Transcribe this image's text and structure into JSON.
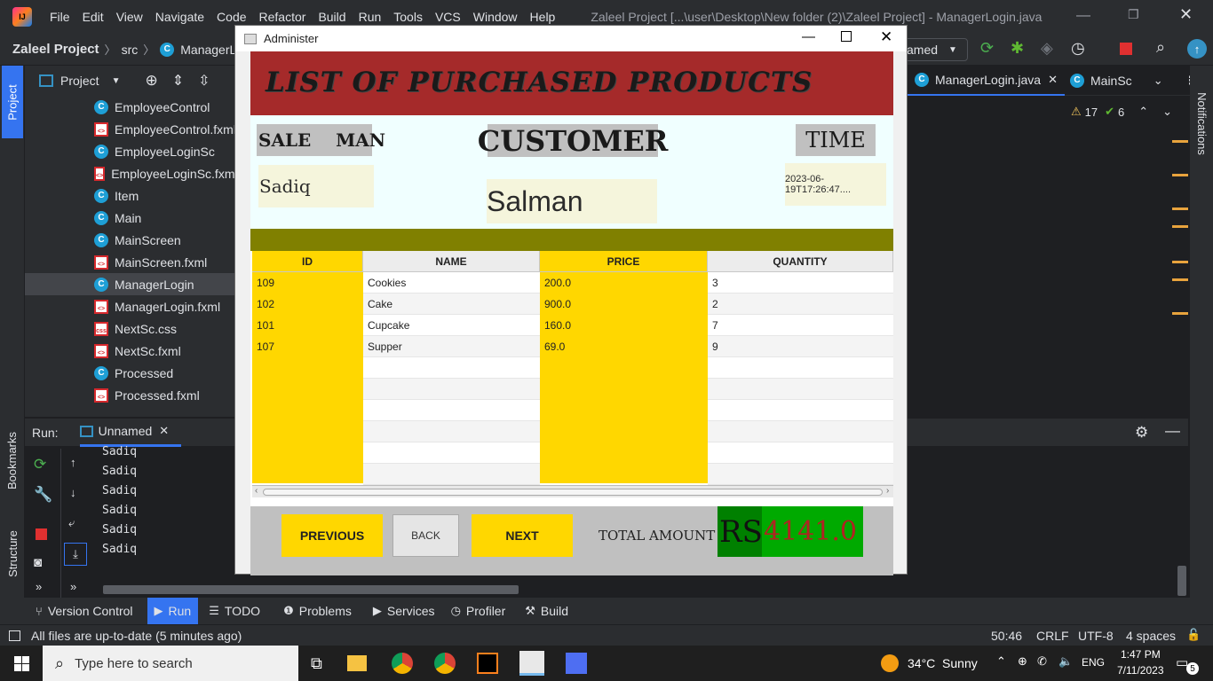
{
  "ide": {
    "menu": [
      "File",
      "Edit",
      "View",
      "Navigate",
      "Code",
      "Refactor",
      "Build",
      "Run",
      "Tools",
      "VCS",
      "Window",
      "Help"
    ],
    "window_title": "Zaleel Project [...\\user\\Desktop\\New folder (2)\\Zaleel Project] - ManagerLogin.java",
    "breadcrumb": {
      "project": "Zaleel Project",
      "src": "src",
      "file": "ManagerLogi"
    },
    "run_config": "amed",
    "project_panel": {
      "title": "Project",
      "items": [
        {
          "name": "EmployeeControl",
          "type": "class"
        },
        {
          "name": "EmployeeControl.fxml",
          "type": "fxml"
        },
        {
          "name": "EmployeeLoginSc",
          "type": "class"
        },
        {
          "name": "EmployeeLoginSc.fxml",
          "type": "fxml"
        },
        {
          "name": "Item",
          "type": "class"
        },
        {
          "name": "Main",
          "type": "class"
        },
        {
          "name": "MainScreen",
          "type": "class"
        },
        {
          "name": "MainScreen.fxml",
          "type": "fxml"
        },
        {
          "name": "ManagerLogin",
          "type": "class",
          "selected": true
        },
        {
          "name": "ManagerLogin.fxml",
          "type": "fxml"
        },
        {
          "name": "NextSc.css",
          "type": "css"
        },
        {
          "name": "NextSc.fxml",
          "type": "fxml"
        },
        {
          "name": "Processed",
          "type": "class"
        },
        {
          "name": "Processed.fxml",
          "type": "fxml"
        }
      ]
    },
    "editor_tabs": [
      "ManagerLogin.java",
      "MainSc"
    ],
    "inspections": {
      "warnings": "17",
      "ok": "6"
    },
    "run_panel": {
      "label": "Run:",
      "tab": "Unnamed",
      "output": [
        "Sadiq",
        "Sadiq",
        "Sadiq",
        "Sadiq",
        "Sadiq",
        "Sadiq"
      ]
    },
    "left_tabs": [
      "Project",
      "Bookmarks",
      "Structure"
    ],
    "right_tab": "Notifications",
    "tool_tabs": [
      "Version Control",
      "Run",
      "TODO",
      "Problems",
      "Services",
      "Profiler",
      "Build"
    ],
    "status": {
      "message": "All files are up-to-date (5 minutes ago)",
      "position": "50:46",
      "line_sep": "CRLF",
      "encoding": "UTF-8",
      "indent": "4 spaces"
    }
  },
  "dialog": {
    "title": "Administer",
    "banner": "LIST OF PURCHASED PRODUCTS",
    "salesman_label": "SALE    MAN",
    "customer_label": "CUSTOMER",
    "time_label": "TIME",
    "salesman": "Sadiq",
    "customer": "Salman",
    "time": "2023-06-19T17:26:47....",
    "columns": [
      "ID",
      "NAME",
      "PRICE",
      "QUANTITY"
    ],
    "rows": [
      [
        "109",
        "Cookies",
        "200.0",
        "3"
      ],
      [
        "102",
        "Cake",
        "900.0",
        "2"
      ],
      [
        "101",
        "Cupcake",
        "160.0",
        "7"
      ],
      [
        "107",
        "Supper",
        "69.0",
        "9"
      ]
    ],
    "buttons": {
      "previous": "PREVIOUS",
      "back": "BACK",
      "next": "NEXT"
    },
    "total_label": "TOTAL AMOUNT",
    "currency": "RS",
    "total": "4141.0"
  },
  "taskbar": {
    "search_placeholder": "Type here to search",
    "weather": "34°C  Sunny",
    "lang": "ENG",
    "time": "1:47 PM",
    "date": "7/11/2023",
    "notif_count": "5"
  },
  "colors": {
    "banner": "#a52a2a",
    "yellow": "#ffd700",
    "olive": "#808000",
    "total_bg": "#00aa00"
  }
}
